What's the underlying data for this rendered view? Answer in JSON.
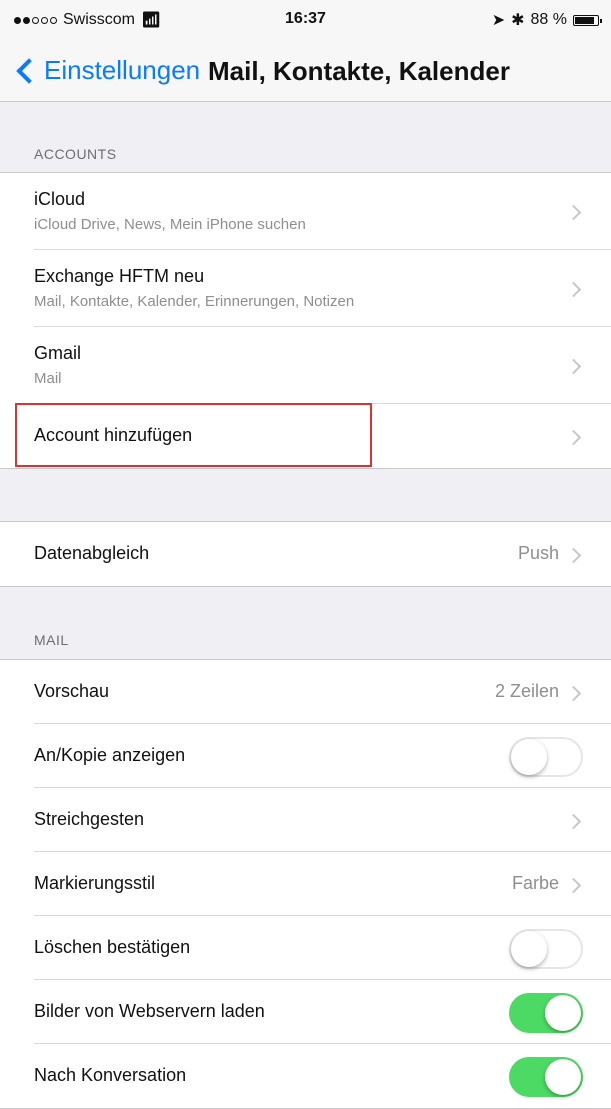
{
  "status_bar": {
    "carrier": "Swisscom",
    "time": "16:37",
    "battery_text": "88 %",
    "battery_level": 0.88
  },
  "nav": {
    "back_label": "Einstellungen",
    "title": "Mail, Kontakte, Kalender"
  },
  "accounts": {
    "header": "ACCOUNTS",
    "items": [
      {
        "title": "iCloud",
        "subtitle": "iCloud Drive, News, Mein iPhone suchen"
      },
      {
        "title": "Exchange HFTM neu",
        "subtitle": "Mail, Kontakte, Kalender, Erinnerungen, Notizen"
      },
      {
        "title": "Gmail",
        "subtitle": "Mail"
      }
    ],
    "add_account": "Account hinzufügen"
  },
  "fetch": {
    "label": "Datenabgleich",
    "value": "Push"
  },
  "mail": {
    "header": "MAIL",
    "rows": [
      {
        "label": "Vorschau",
        "value": "2 Zeilen",
        "type": "value"
      },
      {
        "label": "An/Kopie anzeigen",
        "type": "toggle",
        "on": false
      },
      {
        "label": "Streichgesten",
        "type": "chevron"
      },
      {
        "label": "Markierungsstil",
        "value": "Farbe",
        "type": "value"
      },
      {
        "label": "Löschen bestätigen",
        "type": "toggle",
        "on": false
      },
      {
        "label": "Bilder von Webservern laden",
        "type": "toggle",
        "on": true
      },
      {
        "label": "Nach Konversation",
        "type": "toggle",
        "on": true
      }
    ]
  },
  "colors": {
    "accent": "#0a7bff",
    "toggle_on": "#4cd964",
    "highlight": "#e03030"
  }
}
